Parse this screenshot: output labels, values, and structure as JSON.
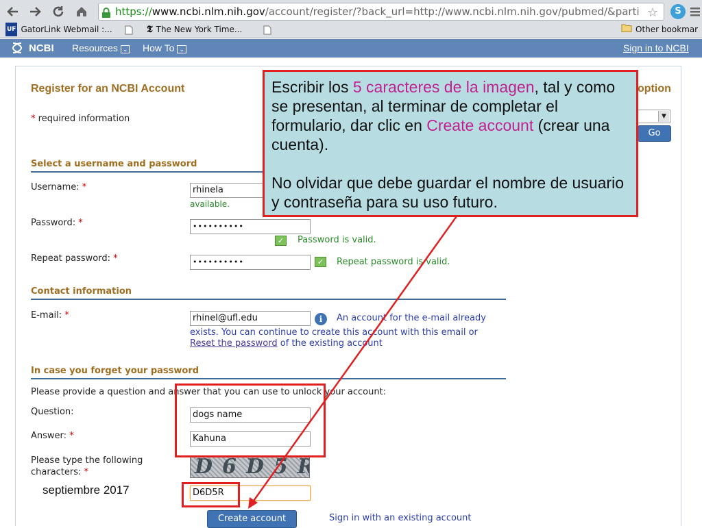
{
  "browser": {
    "url_scheme": "https://",
    "url_host": "www.ncbi.nlm.nih.gov",
    "url_path": "/account/register/?back_url=http://www.ncbi.nlm.nih.gov/pubmed/&parti",
    "bookmarks": [
      {
        "label": "GatorLink Webmail :..."
      },
      {
        "label": "The New York Time..."
      },
      {
        "label": "Other bookmar"
      }
    ]
  },
  "ncbi_bar": {
    "logo": "NCBI",
    "resources": "Resources",
    "howto": "How To",
    "signin": "Sign in to NCBI"
  },
  "page": {
    "title": "Register for an NCBI Account",
    "required_note": "required information",
    "option_partial": "option",
    "go_label": "Go"
  },
  "sections": {
    "credentials": "Select a username and password",
    "contact": "Contact information",
    "forgot": "In case you forget your password"
  },
  "form": {
    "username_label": "Username:",
    "username_value": "rhinela",
    "username_status": "available.",
    "password_label": "Password:",
    "password_value": "••••••••••",
    "password_status": "Password is valid.",
    "repeat_label": "Repeat password:",
    "repeat_value": "••••••••••",
    "repeat_status": "Repeat password is valid.",
    "email_label": "E-mail:",
    "email_value": "rhinel@ufl.edu",
    "email_notice_1": "An account for the e-mail already",
    "email_notice_2": "exists. You can continue to create this account with this email or",
    "reset_link": "Reset the password",
    "email_notice_3": "of the existing account",
    "question_intro": "Please provide a question and answer that you can use to unlock your account:",
    "question_label": "Question:",
    "question_value": "dogs name",
    "answer_label": "Answer:",
    "answer_value": "Kahuna",
    "captcha_label_1": "Please type the following",
    "captcha_label_2": "characters:",
    "captcha_text": "D6D5R",
    "captcha_value": "D6D5R",
    "create_button": "Create account",
    "signin_existing": "Sign in with an existing account"
  },
  "callout": {
    "p1_a": "Escribir los ",
    "p1_b": "5 caracteres de la imagen",
    "p1_c": ", tal y como se presentan, al terminar de completar el formulario, dar clic en ",
    "p1_d": "Create account",
    "p1_e": " (crear una cuenta).",
    "p2": "No olvidar que debe guardar el nombre de usuario y contraseña para su uso futuro."
  },
  "footer_date": "septiembre 2017",
  "colors": {
    "accent_red": "#e02020",
    "ncbi_blue": "#5f86b7",
    "section_gold": "#a06e20",
    "valid_green": "#2a8a2a",
    "callout_bg": "#b7dde3"
  }
}
